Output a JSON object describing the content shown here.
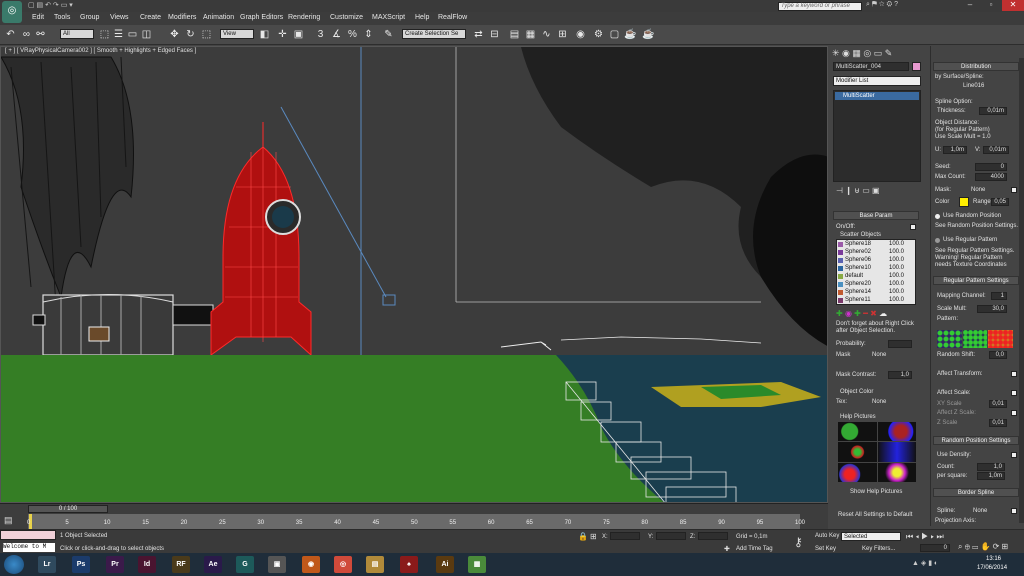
{
  "title_bar": {
    "search_placeholder": "Type a keyword or phrase"
  },
  "menu": [
    "Edit",
    "Tools",
    "Group",
    "Views",
    "Create",
    "Modifiers",
    "Animation",
    "Graph Editors",
    "Rendering",
    "Customize",
    "MAXScript",
    "Help",
    "RealFlow"
  ],
  "toolbar": {
    "selection_filter": "All",
    "ref_coord": "View",
    "named_selection": "Create Selection Se"
  },
  "viewport": {
    "label": "[ + ] [ VRayPhysicalCamera002 ] [ Smooth + Highlights + Edged Faces ]"
  },
  "command_panel": {
    "object_name": "MultiScatter_004",
    "modifier_list": "Modifier List",
    "stack_item": "MultiScatter",
    "base_param_title": "Base Param",
    "on_off": "On/Off:",
    "scatter_objects_title": "Scatter Objects",
    "scatter_objects": [
      {
        "name": "Sphere18",
        "value": "100.0",
        "color": "#9a5aa8"
      },
      {
        "name": "Sphere02",
        "value": "100.0",
        "color": "#7a3a9a"
      },
      {
        "name": "Sphere06",
        "value": "100.0",
        "color": "#5a62b0"
      },
      {
        "name": "Sphere10",
        "value": "100.0",
        "color": "#2a66a0"
      },
      {
        "name": "default",
        "value": "100.0",
        "color": "#88aa44"
      },
      {
        "name": "Sphere20",
        "value": "100.0",
        "color": "#4a90c0"
      },
      {
        "name": "Sphere14",
        "value": "100.0",
        "color": "#c05a30"
      },
      {
        "name": "Sphere11",
        "value": "100.0",
        "color": "#7a3a6a"
      }
    ],
    "dont_forget": "Don't forget about Right Click after Object Selection.",
    "probability": "Probability:",
    "mask": "Mask",
    "mask_none": "None",
    "mask_contrast": "Mask Contrast:",
    "mask_contrast_value": "1,0",
    "object_color_title": "Object Color",
    "tex": "Tex:",
    "tex_none": "None",
    "help_pictures_title": "Help Pictures",
    "show_help_pictures": "Show Help Pictures",
    "reset_all": "Reset All Settings to Default"
  },
  "rollout": {
    "distribution_title": "Distribution",
    "by_surface": "by Surface/Spline:",
    "spline_name": "Line016",
    "spline_option": "Spline Option:",
    "thickness_label": "Thickness:",
    "thickness": "0,01m",
    "object_distance": "Object Distance:",
    "for_regular": "(for Regular Pattern)",
    "use_scale_mult": "Use Scale Mult = 1.0",
    "u_label": "U:",
    "u_value": "1,0m",
    "v_label": "V:",
    "v_value": "0,01m",
    "seed_label": "Seed:",
    "seed": "0",
    "max_count_label": "Max Count:",
    "max_count": "4000",
    "mask_label": "Mask:",
    "mask_none": "None",
    "color_label": "Color",
    "range_label": "Range",
    "range_value": "0,05",
    "use_random_position": "Use Random Position",
    "see_random": "See Random Position Settings.",
    "use_regular_pattern": "Use Regular Pattern",
    "see_regular": "See Regular Pattern Settings.",
    "warning_regular": "Warning! Regular Pattern",
    "needs_texture": "needs Texture Coordinates",
    "regular_pattern_title": "Regular Pattern Settings",
    "mapping_channel_label": "Mapping Channel:",
    "mapping_channel": "1",
    "scale_mult_label": "Scale Mult:",
    "scale_mult": "30,0",
    "pattern_label": "Pattern:",
    "random_shift_label": "Random Shift:",
    "random_shift": "0,0",
    "affect_transform": "Affect Transform:",
    "affect_scale": "Affect Scale:",
    "xy_scale": "XY Scale",
    "xy_scale_value": "0,01",
    "affect_z_scale": "Affect Z Scale:",
    "z_scale": "Z Scale",
    "z_scale_value": "0,01",
    "random_position_title": "Random Position Settings",
    "use_density": "Use Density:",
    "count_label": "Count:",
    "count_value": "1,0",
    "per_square_label": "per square:",
    "per_square_value": "1,0m",
    "border_spline_title": "Border Spline",
    "spline_label": "Spline:",
    "spline_none": "None",
    "projection_axis": "Projection Axis:"
  },
  "timeline": {
    "frame_counter": "0 / 100",
    "ticks": [
      "0",
      "5",
      "10",
      "15",
      "20",
      "25",
      "30",
      "35",
      "40",
      "45",
      "50",
      "55",
      "60",
      "65",
      "70",
      "75",
      "80",
      "85",
      "90",
      "95",
      "100"
    ]
  },
  "status": {
    "maxscript_listener": "Welcome to M",
    "selected_count": "1 Object Selected",
    "prompt": "Click or click-and-drag to select objects",
    "x_label": "X:",
    "y_label": "Y:",
    "z_label": "Z:",
    "grid": "Grid = 0,1m",
    "add_time_tag": "Add Time Tag",
    "auto_key": "Auto Key",
    "set_key": "Set Key",
    "selected_dropdown": "Selected",
    "key_filters": "Key Filters...",
    "frame_field": "0"
  },
  "taskbar": {
    "apps": [
      {
        "label": "Lr",
        "color": "#2f4a5e"
      },
      {
        "label": "Ps",
        "color": "#1b3b6b"
      },
      {
        "label": "Pr",
        "color": "#3b1a4a"
      },
      {
        "label": "Id",
        "color": "#4a1430"
      },
      {
        "label": "RF",
        "color": "#4a3a1a"
      },
      {
        "label": "Ae",
        "color": "#2a1a4a"
      },
      {
        "label": "G",
        "color": "#1d5a5a"
      },
      {
        "label": "▣",
        "color": "#555555"
      },
      {
        "label": "◉",
        "color": "#c0581a"
      },
      {
        "label": "◎",
        "color": "#d04a3a"
      },
      {
        "label": "▤",
        "color": "#b08a3a"
      },
      {
        "label": "♠",
        "color": "#8a1a1a"
      },
      {
        "label": "Ai",
        "color": "#5a3a10"
      },
      {
        "label": "▦",
        "color": "#4a8a3a"
      }
    ],
    "time": "13:16",
    "date": "17/06/2014"
  }
}
